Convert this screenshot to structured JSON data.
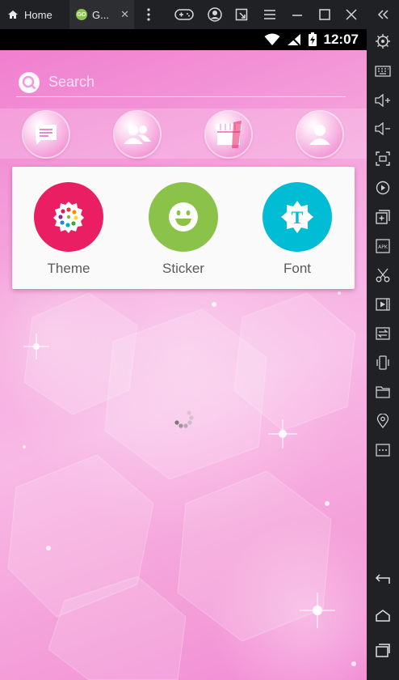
{
  "emulator": {
    "tabs": [
      {
        "label": "Home",
        "icon": "home-icon"
      },
      {
        "label": "G...",
        "icon": "go-app-icon",
        "badge": "GO"
      }
    ],
    "toolbar_icons": [
      "more-vertical-icon",
      "gamepad-icon",
      "account-icon",
      "external-window-icon",
      "menu-icon",
      "minimize-icon",
      "maximize-icon",
      "close-icon"
    ],
    "sidebar_icons": [
      "settings-icon",
      "keyboard-icon",
      "volume-up-icon",
      "volume-down-icon",
      "screenshot-icon",
      "rotate-icon",
      "add-app-icon",
      "apk-icon",
      "cut-icon",
      "record-icon",
      "sync-icon",
      "shake-icon",
      "folder-icon",
      "location-icon",
      "more-icon",
      "back-icon",
      "home-nav-icon",
      "recents-icon"
    ],
    "apk_label": "APK"
  },
  "status_bar": {
    "time": "12:07"
  },
  "search": {
    "placeholder": "Search"
  },
  "category_tabs": [
    {
      "name": "messages",
      "icon": "message-icon"
    },
    {
      "name": "contacts",
      "icon": "contacts-icon"
    },
    {
      "name": "store",
      "icon": "store-icon"
    },
    {
      "name": "profile",
      "icon": "profile-icon"
    }
  ],
  "shortcuts": [
    {
      "label": "Theme",
      "icon": "theme-icon",
      "color": "#e91e63"
    },
    {
      "label": "Sticker",
      "icon": "sticker-icon",
      "color": "#8bc34a"
    },
    {
      "label": "Font",
      "icon": "font-icon",
      "color": "#00bcd4",
      "glyph": "T"
    }
  ],
  "colors": {
    "background_pink": "#f5a6dd",
    "emulator_chrome": "#202124"
  }
}
